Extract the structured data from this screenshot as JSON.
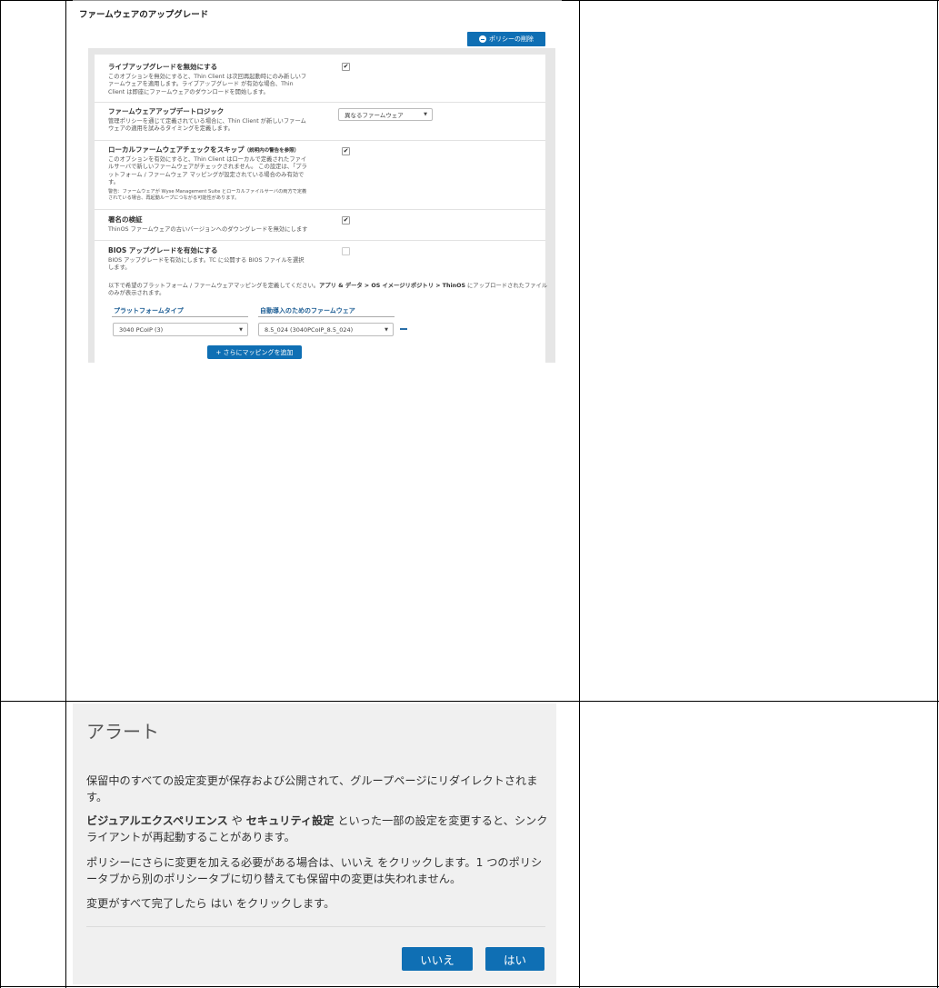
{
  "firmware": {
    "title": "ファームウェアのアップグレード",
    "delete_policy_label": "ポリシーの削除",
    "settings": [
      {
        "title": "ライブアップグレードを無効にする",
        "desc": "このオプションを無効にすると、Thin Client は次回再起動時にのみ新しいフ\nァームウェアを適用します。ライブアップグレード が有効な場合、Thin\nClient は即座にファームウェアのダウンロードを開始します。",
        "checked": true
      },
      {
        "title": "ファームウェアアップデートロジック",
        "desc": "管理ポリシーを通じて定義されている場合に、Thin Client が新しいファーム\nウェアの適用を試みるタイミングを定義します。",
        "select_value": "異なるファームウェア"
      },
      {
        "title": "ローカルファームウェアチェックをスキップ",
        "title_note": "（説明内の警告を参照）",
        "desc": "このオプションを有効にすると、Thin Client はローカルで定義されたファイ\nルサーバで新しいファームウェアがチェックされません。 この設定は、「プラ\nットフォーム / ファームウェア マッピングが設定されている場合のみ有効で\nす。",
        "warn": "警告：ファームウェアが Wyse Management Suite とローカルファイルサーバの両方で定義\nされている場合、再起動ループにつながる可能性があります。",
        "checked": true
      },
      {
        "title": "署名の検証",
        "desc": "ThinOS ファームウェアの古いバージョンへのダウングレードを無効にします",
        "checked": true
      },
      {
        "title": "BIOS アップグレードを有効にする",
        "desc": "BIOS アップグレードを有効にします。TC に公開する BIOS ファイルを選択\nします。",
        "checked": false
      }
    ],
    "mapping_intro_pre": "以下で希望のプラットフォーム / ファームウェアマッピングを定義してください。",
    "mapping_intro_bold": "アプリ & データ > OS イメージリポジトリ > ThinOS",
    "mapping_intro_post": " にアップロードされたファイルのみが表示されます。",
    "platform_type_header": "プラットフォームタイプ",
    "auto_firmware_header": "自動導入のためのファームウェア",
    "platform_value": "3040 PCoIP  (3)",
    "firmware_value": "8.5_024 (3040PCoIP_8.5_024)",
    "add_mapping_label": "+ さらにマッピングを追加"
  },
  "alert": {
    "title": "アラート",
    "p1": "保留中のすべての設定変更が保存および公開されて、グループページにリダイレクトされます。",
    "p2_bold1": "ビジュアルエクスペリエンス",
    "p2_mid": " や ",
    "p2_bold2": "セキュリティ設定",
    "p2_rest": " といった一部の設定を変更すると、シンクライアントが再起動することがあります。",
    "p3": "ポリシーにさらに変更を加える必要がある場合は、いいえ をクリックします。1 つのポリシータブから別のポリシータブに切り替えても保留中の変更は失われません。",
    "p4": "変更がすべて完了したら はい をクリックします。",
    "no_label": "いいえ",
    "yes_label": "はい"
  },
  "colors": {
    "accent": "#0f6fb4",
    "header_blue": "#1c5d94",
    "dialog_bg": "#f0f0f0"
  }
}
